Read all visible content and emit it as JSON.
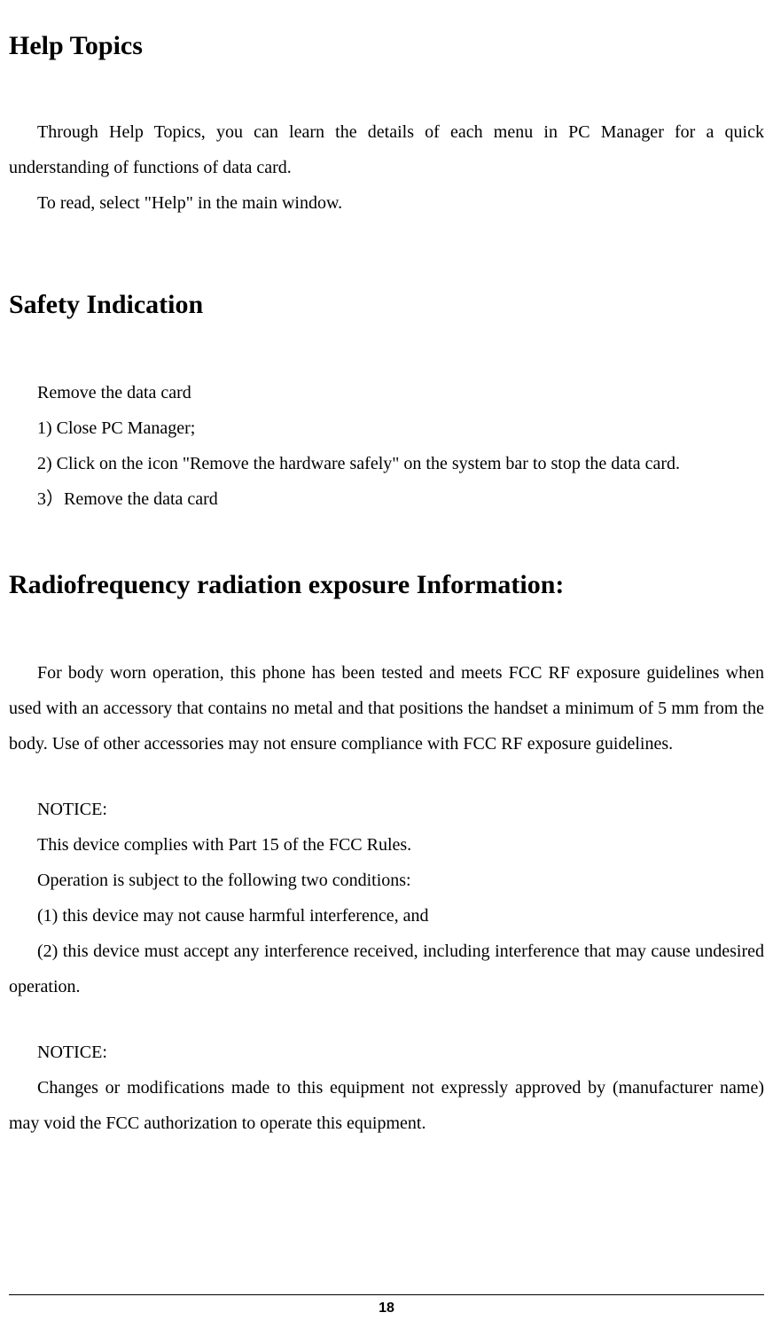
{
  "headings": {
    "help_topics": "Help Topics",
    "safety_indication": "Safety Indication",
    "radiofrequency": "Radiofrequency radiation exposure Information:"
  },
  "help_topics": {
    "p1": "Through Help Topics, you can learn the details of each menu in PC Manager for a quick understanding of functions of data card.",
    "p2": "To read, select \"Help\" in the main window."
  },
  "safety": {
    "l1": "Remove the data card",
    "l2": "1) Close PC Manager;",
    "l3": "2) Click on the icon \"Remove the hardware safely\" on the system bar to stop the data card.",
    "l4": "3）Remove the data card"
  },
  "rf": {
    "p1": "For body worn operation, this phone has been tested and meets FCC RF exposure guidelines when used with an accessory that contains no metal and that positions the handset a minimum of 5 mm from the body. Use of other accessories may not ensure compliance with FCC RF exposure guidelines.",
    "notice1_label": "NOTICE:",
    "notice1_l1": "This device complies with Part 15 of the FCC Rules.",
    "notice1_l2": "Operation is subject to the following two conditions:",
    "notice1_l3": "(1)    this device may not cause harmful interference, and",
    "notice1_l4": "(2)    this device must accept any interference received, including interference that may cause undesired operation.",
    "notice2_label": "NOTICE:",
    "notice2_p": "Changes or modifications made to this equipment not expressly approved by (manufacturer name) may void the FCC authorization to operate this equipment."
  },
  "page_number": "18"
}
